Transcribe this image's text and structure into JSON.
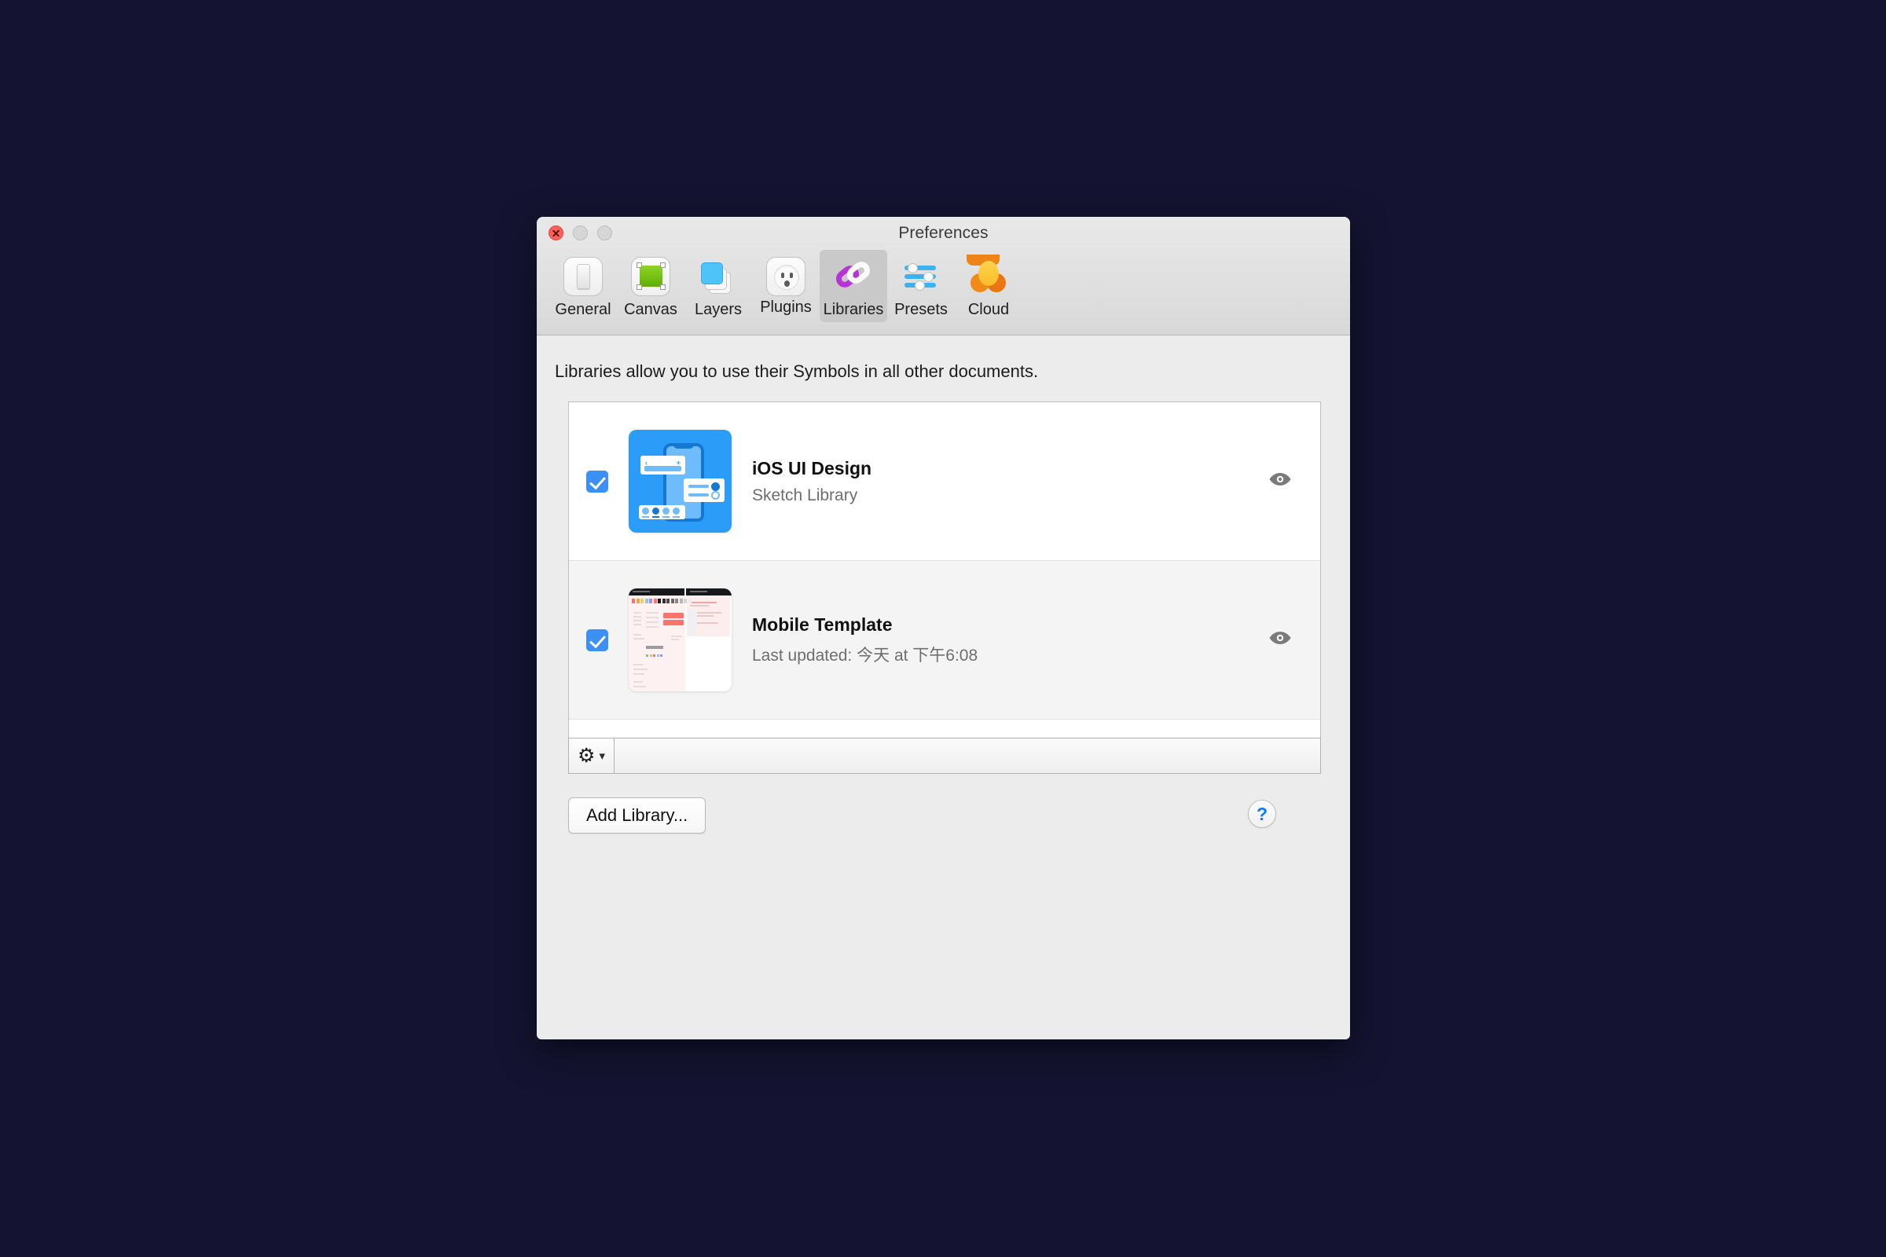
{
  "window": {
    "title": "Preferences",
    "traffic_lights": [
      "close",
      "minimize",
      "maximize"
    ]
  },
  "toolbar": {
    "tabs": [
      {
        "label": "General",
        "icon": "toggle-switch-icon",
        "selected": false
      },
      {
        "label": "Canvas",
        "icon": "green-artboard-icon",
        "selected": false
      },
      {
        "label": "Layers",
        "icon": "stacked-layers-icon",
        "selected": false
      },
      {
        "label": "Plugins",
        "icon": "power-outlet-icon",
        "selected": false
      },
      {
        "label": "Libraries",
        "icon": "linked-rings-icon",
        "selected": true
      },
      {
        "label": "Presets",
        "icon": "sliders-icon",
        "selected": false
      },
      {
        "label": "Cloud",
        "icon": "cloud-icon",
        "selected": false
      }
    ]
  },
  "main": {
    "description": "Libraries allow you to use their Symbols in all other documents.",
    "libraries": [
      {
        "checked": true,
        "title": "iOS UI Design",
        "subtitle": "Sketch Library",
        "thumbnail": "ios-ui-design-thumbnail",
        "visibility_icon": "eye-icon"
      },
      {
        "checked": true,
        "title": "Mobile Template",
        "subtitle": "Last updated: 今天 at 下午6:08",
        "thumbnail": "mobile-template-thumbnail",
        "visibility_icon": "eye-icon"
      }
    ],
    "gear_menu": {
      "icon": "gear-icon",
      "chevron": "chevron-down-icon"
    },
    "add_library_label": "Add Library...",
    "help_label": "?"
  },
  "colors": {
    "accent_blue": "#3b8ff5",
    "help_blue": "#0a7cff",
    "libraries_ring_purple": "#b833d6",
    "canvas_green": "#7fc91b",
    "cloud_orange": "#ef8416",
    "close_red": "#ff6159",
    "desktop_background": "#141432"
  }
}
